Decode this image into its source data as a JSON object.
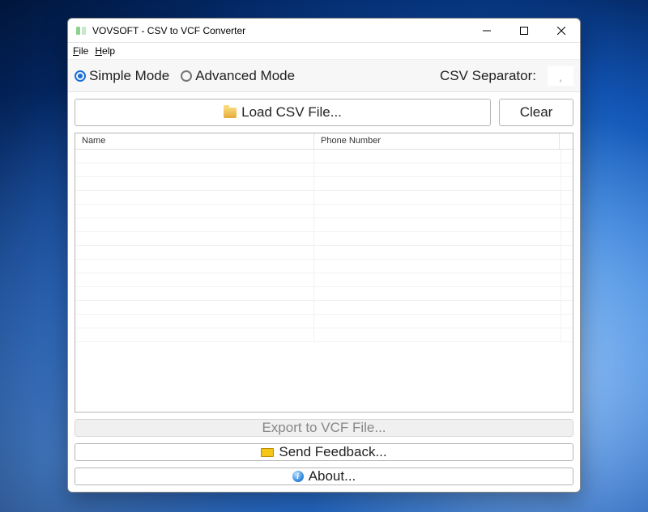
{
  "window": {
    "title": "VOVSOFT - CSV to VCF Converter"
  },
  "menubar": {
    "file": "File",
    "help": "Help"
  },
  "toolbar": {
    "simple_mode": "Simple Mode",
    "advanced_mode": "Advanced Mode",
    "separator_label": "CSV Separator:",
    "separator_value": ","
  },
  "actions": {
    "load_csv": "Load CSV File...",
    "clear": "Clear",
    "export": "Export to VCF File...",
    "feedback": "Send Feedback...",
    "about": "About..."
  },
  "table": {
    "columns": {
      "name": "Name",
      "phone": "Phone Number"
    },
    "rows": []
  },
  "icons": {
    "app": "app-icon",
    "folder": "folder-icon",
    "mail": "mail-icon",
    "info": "info-icon",
    "min": "minimize-icon",
    "max": "maximize-icon",
    "close": "close-icon"
  }
}
